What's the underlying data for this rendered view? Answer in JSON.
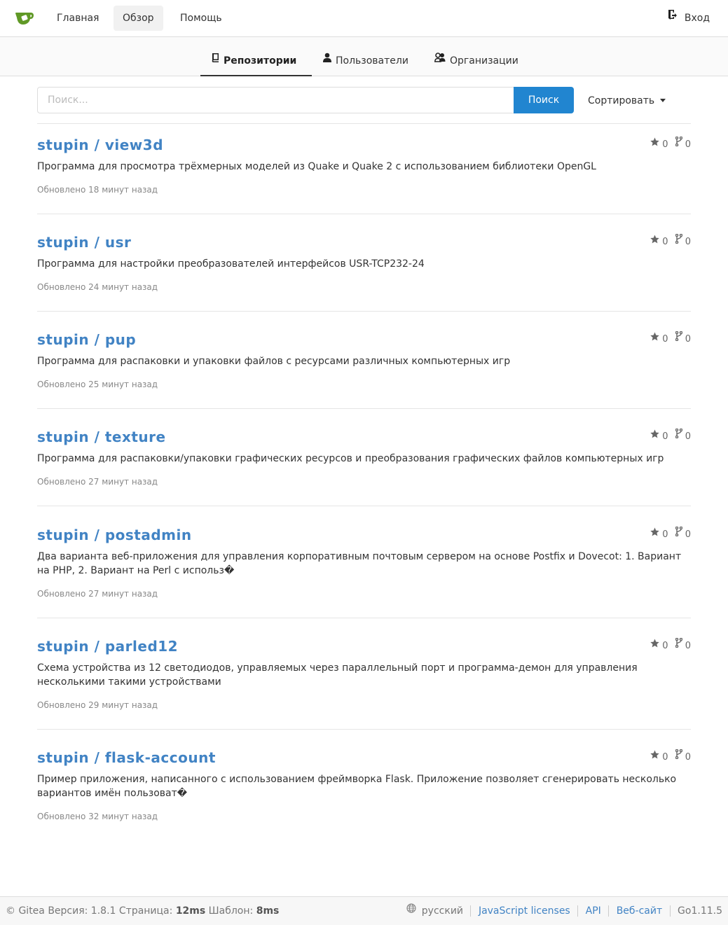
{
  "navbar": {
    "home": "Главная",
    "explore": "Обзор",
    "help": "Помощь",
    "login": "Вход"
  },
  "tabs": {
    "repos": "Репозитории",
    "users": "Пользователи",
    "orgs": "Организации"
  },
  "search": {
    "placeholder": "Поиск...",
    "button": "Поиск",
    "sort": "Сортировать"
  },
  "repos": [
    {
      "title": "stupin / view3d",
      "stars": "0",
      "forks": "0",
      "description": "Программа для просмотра трёхмерных моделей из Quake и Quake 2 с использованием библиотеки OpenGL",
      "updated": "Обновлено 18 минут назад"
    },
    {
      "title": "stupin / usr",
      "stars": "0",
      "forks": "0",
      "description": "Программа для настройки преобразователей интерфейсов USR-TCP232-24",
      "updated": "Обновлено 24 минут назад"
    },
    {
      "title": "stupin / pup",
      "stars": "0",
      "forks": "0",
      "description": "Программа для распаковки и упаковки файлов с ресурсами различных компьютерных игр",
      "updated": "Обновлено 25 минут назад"
    },
    {
      "title": "stupin / texture",
      "stars": "0",
      "forks": "0",
      "description": "Программа для распаковки/упаковки графических ресурсов и преобразования графических файлов компьютерных игр",
      "updated": "Обновлено 27 минут назад"
    },
    {
      "title": "stupin / postadmin",
      "stars": "0",
      "forks": "0",
      "description": "Два варианта веб-приложения для управления корпоративным почтовым сервером на основе Postfix и Dovecot: 1. Вариант на PHP, 2. Вариант на Perl с использ�",
      "updated": "Обновлено 27 минут назад"
    },
    {
      "title": "stupin / parled12",
      "stars": "0",
      "forks": "0",
      "description": "Схема устройства из 12 светодиодов, управляемых через параллельный порт и программа-демон для управления несколькими такими устройствами",
      "updated": "Обновлено 29 минут назад"
    },
    {
      "title": "stupin / flask-account",
      "stars": "0",
      "forks": "0",
      "description": "Пример приложения, написанного с использованием фреймворка Flask. Приложение позволяет сгенерировать несколько вариантов имён пользоват�",
      "updated": "Обновлено 32 минут назад"
    }
  ],
  "footer": {
    "copyright": "© Gitea Версия: 1.8.1 Страница:",
    "page_time": "12ms",
    "template_label": "Шаблон:",
    "template_time": "8ms",
    "language": "русский",
    "js_licenses": "JavaScript licenses",
    "api": "API",
    "website": "Веб-сайт",
    "go_version": "Go1.11.5"
  },
  "colors": {
    "accent": "#2185d0",
    "link": "#4183c4",
    "logo": "#609926"
  }
}
